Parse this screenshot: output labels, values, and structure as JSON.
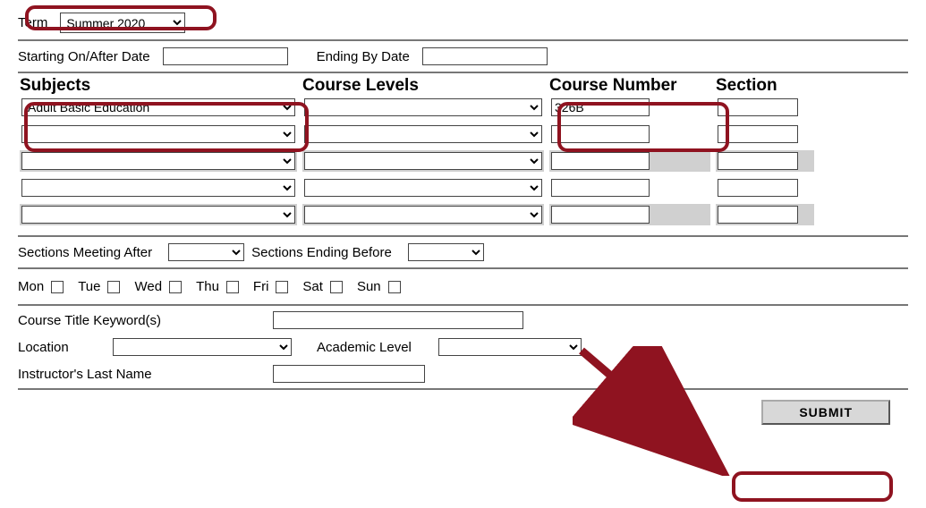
{
  "term": {
    "label": "Term",
    "selected": "Summer 2020"
  },
  "dates": {
    "start_label": "Starting On/After Date",
    "end_label": "Ending By Date",
    "start_value": "",
    "end_value": ""
  },
  "grid": {
    "headers": {
      "subjects": "Subjects",
      "levels": "Course Levels",
      "course": "Course Number",
      "section": "Section"
    },
    "rows": [
      {
        "shaded": false,
        "subject": "Adult Basic Education",
        "level": "",
        "course": "326B",
        "section": ""
      },
      {
        "shaded": false,
        "subject": "",
        "level": "",
        "course": "",
        "section": ""
      },
      {
        "shaded": true,
        "subject": "",
        "level": "",
        "course": "",
        "section": ""
      },
      {
        "shaded": false,
        "subject": "",
        "level": "",
        "course": "",
        "section": ""
      },
      {
        "shaded": true,
        "subject": "",
        "level": "",
        "course": "",
        "section": ""
      }
    ]
  },
  "times": {
    "after_label": "Sections Meeting After",
    "after_value": "",
    "before_label": "Sections Ending Before",
    "before_value": ""
  },
  "days": {
    "items": [
      {
        "label": "Mon",
        "checked": false
      },
      {
        "label": "Tue",
        "checked": false
      },
      {
        "label": "Wed",
        "checked": false
      },
      {
        "label": "Thu",
        "checked": false
      },
      {
        "label": "Fri",
        "checked": false
      },
      {
        "label": "Sat",
        "checked": false
      },
      {
        "label": "Sun",
        "checked": false
      }
    ]
  },
  "extras": {
    "keyword_label": "Course Title Keyword(s)",
    "keyword_value": "",
    "location_label": "Location",
    "location_value": "",
    "academic_label": "Academic Level",
    "academic_value": "",
    "instructor_label": "Instructor's Last Name",
    "instructor_value": ""
  },
  "buttons": {
    "submit": "SUBMIT"
  }
}
